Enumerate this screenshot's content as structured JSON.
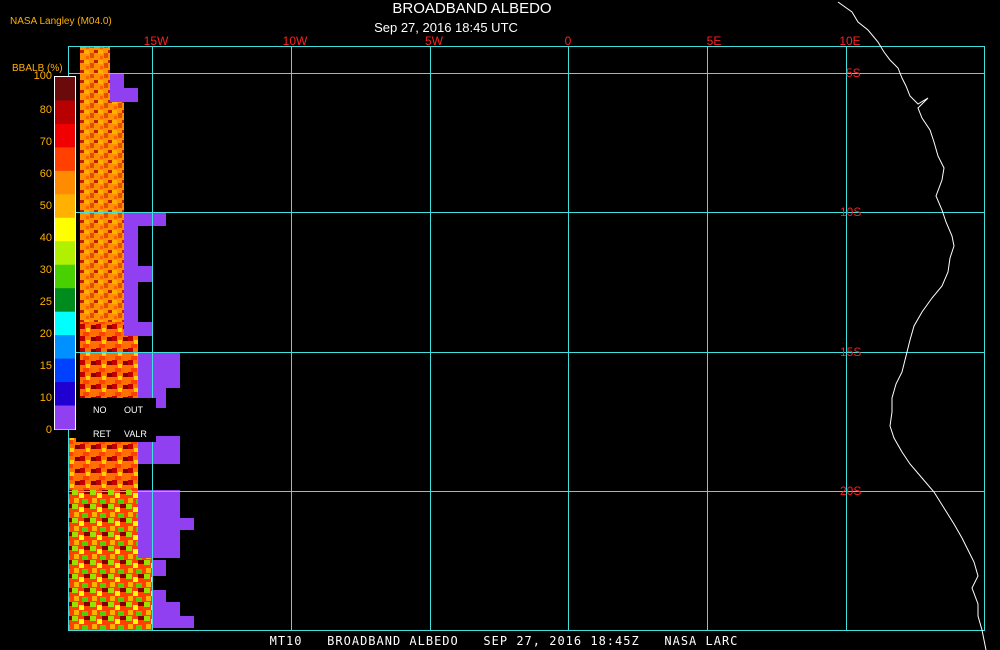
{
  "header": {
    "title": "BROADBAND ALBEDO",
    "datetime": "Sep 27, 2016 18:45 UTC",
    "provider": "NASA Langley (M04.0)"
  },
  "footer": {
    "text": "MT10   BROADBAND ALBEDO   SEP 27, 2016 18:45Z   NASA LARC"
  },
  "map": {
    "lon_labels": [
      "15W",
      "10W",
      "5W",
      "0",
      "5E",
      "10E"
    ],
    "lat_labels": [
      "5S",
      "10S",
      "15S",
      "20S"
    ],
    "grid_color": "#40e0e0",
    "label_color": "#ff2020",
    "coast_color": "#ffffff"
  },
  "colorbar": {
    "title": "BBALB (%)",
    "ticks": [
      "100",
      "80",
      "70",
      "60",
      "50",
      "40",
      "30",
      "25",
      "20",
      "15",
      "10",
      "0"
    ],
    "colors": [
      "#6a0a0a",
      "#b80000",
      "#f00000",
      "#ff4000",
      "#ff8c00",
      "#ffb000",
      "#ffff00",
      "#b0f000",
      "#48d000",
      "#008c1c",
      "#00ffff",
      "#0090ff",
      "#0040ff",
      "#2000d0",
      "#9040f0"
    ],
    "no_ret": [
      "NO",
      "RET"
    ],
    "out_valr": [
      "OUT",
      "VALR"
    ]
  }
}
